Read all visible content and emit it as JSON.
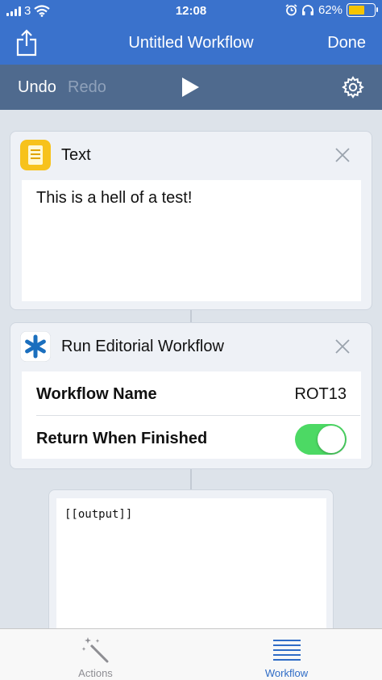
{
  "status_bar": {
    "carrier": "3",
    "time": "12:08",
    "battery": "62%",
    "battery_level": 0.62
  },
  "nav": {
    "title": "Untitled Workflow",
    "done_label": "Done"
  },
  "toolbar": {
    "undo_label": "Undo",
    "redo_label": "Redo"
  },
  "actions": [
    {
      "title": "Text",
      "content": "This is a hell of a test!"
    },
    {
      "title": "Run Editorial Workflow",
      "rows": [
        {
          "label": "Workflow Name",
          "value": "ROT13"
        },
        {
          "label": "Return When Finished",
          "toggle_on": true
        }
      ]
    }
  ],
  "output_card": {
    "text": "[[output]]"
  },
  "tabbar": {
    "tabs": [
      {
        "label": "Actions",
        "active": false
      },
      {
        "label": "Workflow",
        "active": true
      }
    ]
  },
  "colors": {
    "nav_blue": "#3a72cc",
    "toolbar": "#4f6a8e",
    "toggle_green": "#4cd964",
    "tab_active": "#2f6cc6",
    "tab_inactive": "#8e8e93",
    "text_icon_yellow": "#f7c21b"
  },
  "icons": [
    "share-icon",
    "play-icon",
    "gear-icon",
    "text-app-icon",
    "editorial-app-icon",
    "close-icon",
    "magic-wand-icon",
    "list-icon"
  ]
}
